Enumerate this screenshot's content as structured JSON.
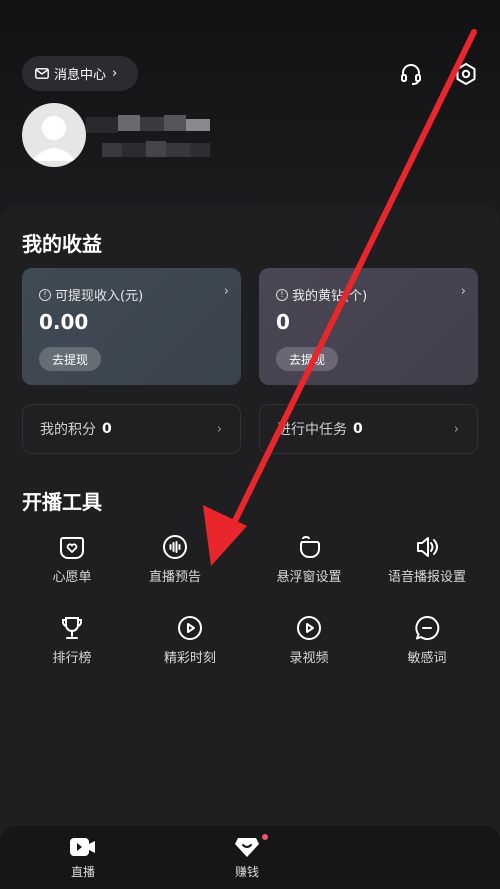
{
  "header": {
    "message_center_label": "消息中心",
    "message_center_chevron": "›"
  },
  "profile": {
    "avatar": "default-avatar-icon"
  },
  "earnings": {
    "title": "我的收益",
    "withdrawable_label": "可提现收入(元)",
    "withdrawable_value": "0.00",
    "withdraw_button": "去提现",
    "coins_label": "我的黄钻(个)",
    "coins_value": "0",
    "coins_button": "去提现",
    "info_glyph": "!",
    "chevron": "›",
    "points_label": "我的积分",
    "points_value": "0",
    "tasks_label": "进行中任务",
    "tasks_value": "0"
  },
  "tools": {
    "title": "开播工具",
    "items": [
      {
        "label": "心愿单",
        "icon": "heart-chat-icon"
      },
      {
        "label": "直播预告",
        "icon": "live-preview-icon"
      },
      {
        "label": "悬浮窗设置",
        "icon": "float-window-icon"
      },
      {
        "label": "语音播报设置",
        "icon": "speaker-icon"
      },
      {
        "label": "排行榜",
        "icon": "trophy-icon"
      },
      {
        "label": "精彩时刻",
        "icon": "play-circle-icon"
      },
      {
        "label": "录视频",
        "icon": "record-video-icon"
      },
      {
        "label": "敏感词",
        "icon": "chat-bubble-icon"
      }
    ]
  },
  "tabbar": {
    "live_label": "直播",
    "earn_label": "赚钱"
  },
  "colors": {
    "background": "#1a1a1d",
    "card_a": "#404a55",
    "card_b": "#4a4654",
    "annotation_arrow": "#e8262b",
    "badge": "#f0546a"
  }
}
